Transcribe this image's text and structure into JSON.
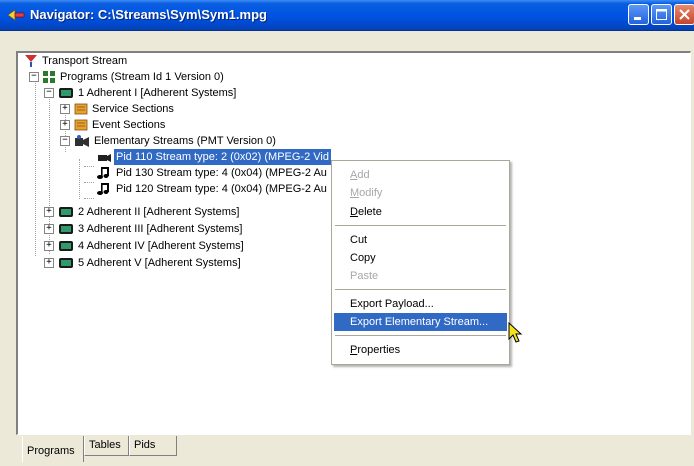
{
  "window": {
    "title": "Navigator: C:\\Streams\\Sym\\Sym1.mpg",
    "colors": {
      "titlebar": "#0054e3",
      "selection": "#316ac5",
      "background": "#ece9d8"
    }
  },
  "tree": {
    "root": {
      "label": "Transport Stream",
      "icon": "transport-stream-icon"
    },
    "programs": {
      "label": "Programs (Stream Id 1 Version 0)",
      "expander": "−",
      "icon": "programs-grid-icon"
    },
    "program1": {
      "label": "1 Adherent I [Adherent Systems]",
      "expander": "−",
      "icon": "program-tv-icon"
    },
    "service_sections": {
      "label": "Service Sections",
      "expander": "+",
      "icon": "sections-icon"
    },
    "event_sections": {
      "label": "Event Sections",
      "expander": "+",
      "icon": "sections-icon"
    },
    "elementary_streams": {
      "label": "Elementary Streams (PMT Version 0)",
      "expander": "−",
      "icon": "elementary-streams-icon"
    },
    "pid110": {
      "label": "Pid 110 Stream type: 2 (0x02) (MPEG-2 Vid",
      "icon": "video-stream-icon",
      "selected": true
    },
    "pid130": {
      "label": "Pid 130 Stream type: 4 (0x04) (MPEG-2 Au",
      "icon": "audio-note-icon"
    },
    "pid120": {
      "label": "Pid 120 Stream type: 4 (0x04) (MPEG-2 Au",
      "icon": "audio-note-icon"
    },
    "program2": {
      "label": "2 Adherent II [Adherent Systems]",
      "expander": "+",
      "icon": "program-tv-icon"
    },
    "program3": {
      "label": "3 Adherent III [Adherent Systems]",
      "expander": "+",
      "icon": "program-tv-icon"
    },
    "program4": {
      "label": "4 Adherent IV [Adherent Systems]",
      "expander": "+",
      "icon": "program-tv-icon"
    },
    "program5": {
      "label": "5 Adherent V [Adherent Systems]",
      "expander": "+",
      "icon": "program-tv-icon"
    }
  },
  "context_menu": {
    "add": "Add",
    "modify": "Modify",
    "delete": "Delete",
    "cut": "Cut",
    "copy": "Copy",
    "paste": "Paste",
    "export_payload": "Export Payload...",
    "export_elementary_stream": "Export Elementary Stream...",
    "properties": "Properties"
  },
  "tabs": [
    {
      "label": "Programs",
      "active": true
    },
    {
      "label": "Tables",
      "active": false
    },
    {
      "label": "Pids",
      "active": false
    }
  ]
}
